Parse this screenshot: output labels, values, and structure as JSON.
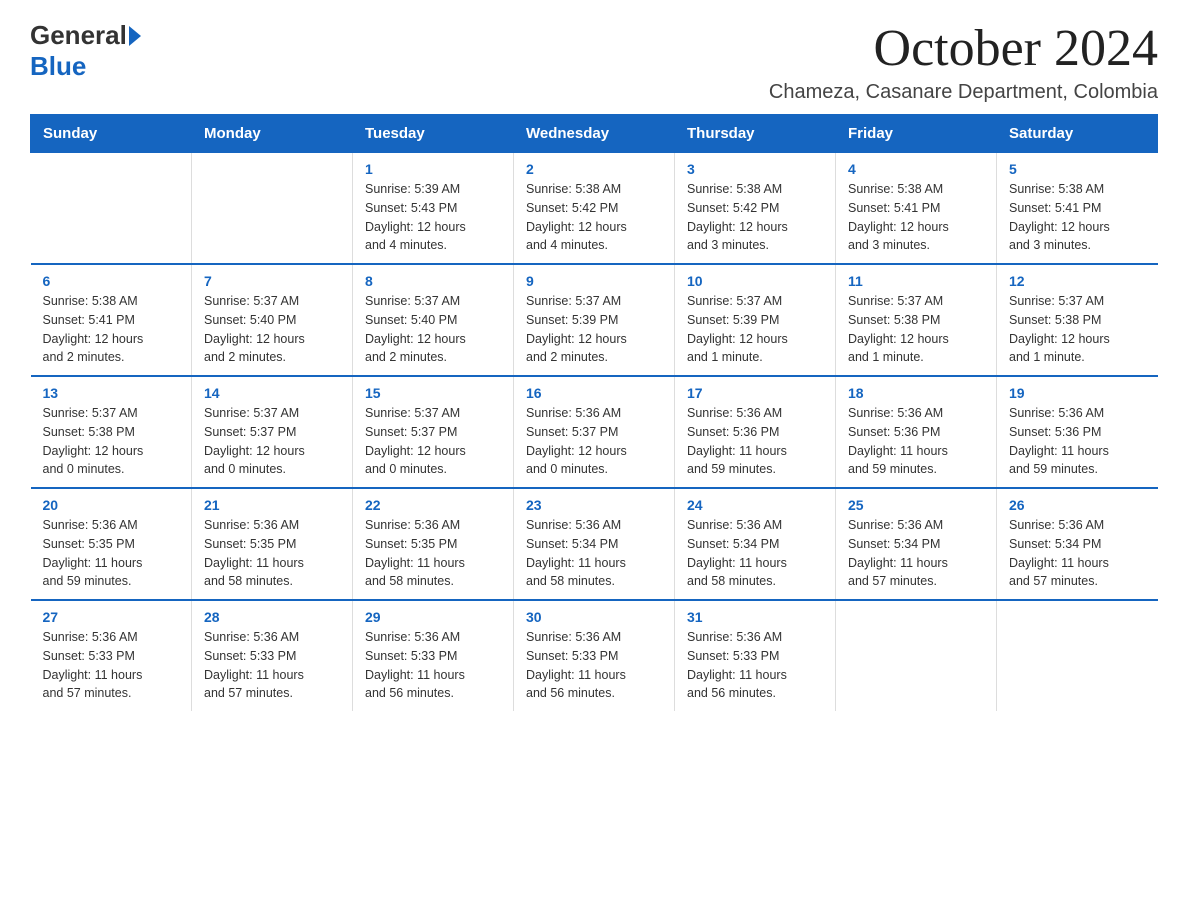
{
  "header": {
    "logo_general": "General",
    "logo_blue": "Blue",
    "month_title": "October 2024",
    "location": "Chameza, Casanare Department, Colombia"
  },
  "calendar": {
    "days_of_week": [
      "Sunday",
      "Monday",
      "Tuesday",
      "Wednesday",
      "Thursday",
      "Friday",
      "Saturday"
    ],
    "weeks": [
      [
        {
          "day": "",
          "info": ""
        },
        {
          "day": "",
          "info": ""
        },
        {
          "day": "1",
          "info": "Sunrise: 5:39 AM\nSunset: 5:43 PM\nDaylight: 12 hours\nand 4 minutes."
        },
        {
          "day": "2",
          "info": "Sunrise: 5:38 AM\nSunset: 5:42 PM\nDaylight: 12 hours\nand 4 minutes."
        },
        {
          "day": "3",
          "info": "Sunrise: 5:38 AM\nSunset: 5:42 PM\nDaylight: 12 hours\nand 3 minutes."
        },
        {
          "day": "4",
          "info": "Sunrise: 5:38 AM\nSunset: 5:41 PM\nDaylight: 12 hours\nand 3 minutes."
        },
        {
          "day": "5",
          "info": "Sunrise: 5:38 AM\nSunset: 5:41 PM\nDaylight: 12 hours\nand 3 minutes."
        }
      ],
      [
        {
          "day": "6",
          "info": "Sunrise: 5:38 AM\nSunset: 5:41 PM\nDaylight: 12 hours\nand 2 minutes."
        },
        {
          "day": "7",
          "info": "Sunrise: 5:37 AM\nSunset: 5:40 PM\nDaylight: 12 hours\nand 2 minutes."
        },
        {
          "day": "8",
          "info": "Sunrise: 5:37 AM\nSunset: 5:40 PM\nDaylight: 12 hours\nand 2 minutes."
        },
        {
          "day": "9",
          "info": "Sunrise: 5:37 AM\nSunset: 5:39 PM\nDaylight: 12 hours\nand 2 minutes."
        },
        {
          "day": "10",
          "info": "Sunrise: 5:37 AM\nSunset: 5:39 PM\nDaylight: 12 hours\nand 1 minute."
        },
        {
          "day": "11",
          "info": "Sunrise: 5:37 AM\nSunset: 5:38 PM\nDaylight: 12 hours\nand 1 minute."
        },
        {
          "day": "12",
          "info": "Sunrise: 5:37 AM\nSunset: 5:38 PM\nDaylight: 12 hours\nand 1 minute."
        }
      ],
      [
        {
          "day": "13",
          "info": "Sunrise: 5:37 AM\nSunset: 5:38 PM\nDaylight: 12 hours\nand 0 minutes."
        },
        {
          "day": "14",
          "info": "Sunrise: 5:37 AM\nSunset: 5:37 PM\nDaylight: 12 hours\nand 0 minutes."
        },
        {
          "day": "15",
          "info": "Sunrise: 5:37 AM\nSunset: 5:37 PM\nDaylight: 12 hours\nand 0 minutes."
        },
        {
          "day": "16",
          "info": "Sunrise: 5:36 AM\nSunset: 5:37 PM\nDaylight: 12 hours\nand 0 minutes."
        },
        {
          "day": "17",
          "info": "Sunrise: 5:36 AM\nSunset: 5:36 PM\nDaylight: 11 hours\nand 59 minutes."
        },
        {
          "day": "18",
          "info": "Sunrise: 5:36 AM\nSunset: 5:36 PM\nDaylight: 11 hours\nand 59 minutes."
        },
        {
          "day": "19",
          "info": "Sunrise: 5:36 AM\nSunset: 5:36 PM\nDaylight: 11 hours\nand 59 minutes."
        }
      ],
      [
        {
          "day": "20",
          "info": "Sunrise: 5:36 AM\nSunset: 5:35 PM\nDaylight: 11 hours\nand 59 minutes."
        },
        {
          "day": "21",
          "info": "Sunrise: 5:36 AM\nSunset: 5:35 PM\nDaylight: 11 hours\nand 58 minutes."
        },
        {
          "day": "22",
          "info": "Sunrise: 5:36 AM\nSunset: 5:35 PM\nDaylight: 11 hours\nand 58 minutes."
        },
        {
          "day": "23",
          "info": "Sunrise: 5:36 AM\nSunset: 5:34 PM\nDaylight: 11 hours\nand 58 minutes."
        },
        {
          "day": "24",
          "info": "Sunrise: 5:36 AM\nSunset: 5:34 PM\nDaylight: 11 hours\nand 58 minutes."
        },
        {
          "day": "25",
          "info": "Sunrise: 5:36 AM\nSunset: 5:34 PM\nDaylight: 11 hours\nand 57 minutes."
        },
        {
          "day": "26",
          "info": "Sunrise: 5:36 AM\nSunset: 5:34 PM\nDaylight: 11 hours\nand 57 minutes."
        }
      ],
      [
        {
          "day": "27",
          "info": "Sunrise: 5:36 AM\nSunset: 5:33 PM\nDaylight: 11 hours\nand 57 minutes."
        },
        {
          "day": "28",
          "info": "Sunrise: 5:36 AM\nSunset: 5:33 PM\nDaylight: 11 hours\nand 57 minutes."
        },
        {
          "day": "29",
          "info": "Sunrise: 5:36 AM\nSunset: 5:33 PM\nDaylight: 11 hours\nand 56 minutes."
        },
        {
          "day": "30",
          "info": "Sunrise: 5:36 AM\nSunset: 5:33 PM\nDaylight: 11 hours\nand 56 minutes."
        },
        {
          "day": "31",
          "info": "Sunrise: 5:36 AM\nSunset: 5:33 PM\nDaylight: 11 hours\nand 56 minutes."
        },
        {
          "day": "",
          "info": ""
        },
        {
          "day": "",
          "info": ""
        }
      ]
    ]
  }
}
